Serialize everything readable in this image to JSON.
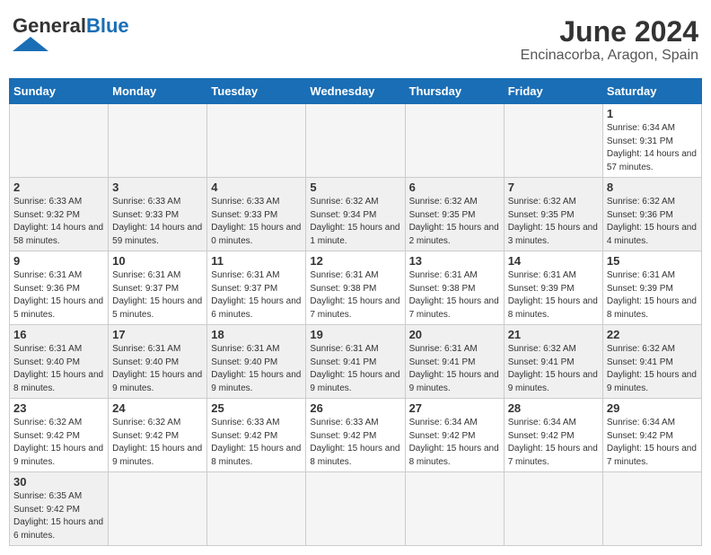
{
  "header": {
    "logo_general": "General",
    "logo_blue": "Blue",
    "month_title": "June 2024",
    "location": "Encinacorba, Aragon, Spain"
  },
  "days_of_week": [
    "Sunday",
    "Monday",
    "Tuesday",
    "Wednesday",
    "Thursday",
    "Friday",
    "Saturday"
  ],
  "weeks": [
    [
      {
        "day": "",
        "info": ""
      },
      {
        "day": "",
        "info": ""
      },
      {
        "day": "",
        "info": ""
      },
      {
        "day": "",
        "info": ""
      },
      {
        "day": "",
        "info": ""
      },
      {
        "day": "",
        "info": ""
      },
      {
        "day": "1",
        "info": "Sunrise: 6:34 AM\nSunset: 9:31 PM\nDaylight: 14 hours and 57 minutes."
      }
    ],
    [
      {
        "day": "2",
        "info": "Sunrise: 6:33 AM\nSunset: 9:32 PM\nDaylight: 14 hours and 58 minutes."
      },
      {
        "day": "3",
        "info": "Sunrise: 6:33 AM\nSunset: 9:33 PM\nDaylight: 14 hours and 59 minutes."
      },
      {
        "day": "4",
        "info": "Sunrise: 6:33 AM\nSunset: 9:33 PM\nDaylight: 15 hours and 0 minutes."
      },
      {
        "day": "5",
        "info": "Sunrise: 6:32 AM\nSunset: 9:34 PM\nDaylight: 15 hours and 1 minute."
      },
      {
        "day": "6",
        "info": "Sunrise: 6:32 AM\nSunset: 9:35 PM\nDaylight: 15 hours and 2 minutes."
      },
      {
        "day": "7",
        "info": "Sunrise: 6:32 AM\nSunset: 9:35 PM\nDaylight: 15 hours and 3 minutes."
      },
      {
        "day": "8",
        "info": "Sunrise: 6:32 AM\nSunset: 9:36 PM\nDaylight: 15 hours and 4 minutes."
      }
    ],
    [
      {
        "day": "9",
        "info": "Sunrise: 6:31 AM\nSunset: 9:36 PM\nDaylight: 15 hours and 5 minutes."
      },
      {
        "day": "10",
        "info": "Sunrise: 6:31 AM\nSunset: 9:37 PM\nDaylight: 15 hours and 5 minutes."
      },
      {
        "day": "11",
        "info": "Sunrise: 6:31 AM\nSunset: 9:37 PM\nDaylight: 15 hours and 6 minutes."
      },
      {
        "day": "12",
        "info": "Sunrise: 6:31 AM\nSunset: 9:38 PM\nDaylight: 15 hours and 7 minutes."
      },
      {
        "day": "13",
        "info": "Sunrise: 6:31 AM\nSunset: 9:38 PM\nDaylight: 15 hours and 7 minutes."
      },
      {
        "day": "14",
        "info": "Sunrise: 6:31 AM\nSunset: 9:39 PM\nDaylight: 15 hours and 8 minutes."
      },
      {
        "day": "15",
        "info": "Sunrise: 6:31 AM\nSunset: 9:39 PM\nDaylight: 15 hours and 8 minutes."
      }
    ],
    [
      {
        "day": "16",
        "info": "Sunrise: 6:31 AM\nSunset: 9:40 PM\nDaylight: 15 hours and 8 minutes."
      },
      {
        "day": "17",
        "info": "Sunrise: 6:31 AM\nSunset: 9:40 PM\nDaylight: 15 hours and 9 minutes."
      },
      {
        "day": "18",
        "info": "Sunrise: 6:31 AM\nSunset: 9:40 PM\nDaylight: 15 hours and 9 minutes."
      },
      {
        "day": "19",
        "info": "Sunrise: 6:31 AM\nSunset: 9:41 PM\nDaylight: 15 hours and 9 minutes."
      },
      {
        "day": "20",
        "info": "Sunrise: 6:31 AM\nSunset: 9:41 PM\nDaylight: 15 hours and 9 minutes."
      },
      {
        "day": "21",
        "info": "Sunrise: 6:32 AM\nSunset: 9:41 PM\nDaylight: 15 hours and 9 minutes."
      },
      {
        "day": "22",
        "info": "Sunrise: 6:32 AM\nSunset: 9:41 PM\nDaylight: 15 hours and 9 minutes."
      }
    ],
    [
      {
        "day": "23",
        "info": "Sunrise: 6:32 AM\nSunset: 9:42 PM\nDaylight: 15 hours and 9 minutes."
      },
      {
        "day": "24",
        "info": "Sunrise: 6:32 AM\nSunset: 9:42 PM\nDaylight: 15 hours and 9 minutes."
      },
      {
        "day": "25",
        "info": "Sunrise: 6:33 AM\nSunset: 9:42 PM\nDaylight: 15 hours and 8 minutes."
      },
      {
        "day": "26",
        "info": "Sunrise: 6:33 AM\nSunset: 9:42 PM\nDaylight: 15 hours and 8 minutes."
      },
      {
        "day": "27",
        "info": "Sunrise: 6:34 AM\nSunset: 9:42 PM\nDaylight: 15 hours and 8 minutes."
      },
      {
        "day": "28",
        "info": "Sunrise: 6:34 AM\nSunset: 9:42 PM\nDaylight: 15 hours and 7 minutes."
      },
      {
        "day": "29",
        "info": "Sunrise: 6:34 AM\nSunset: 9:42 PM\nDaylight: 15 hours and 7 minutes."
      }
    ],
    [
      {
        "day": "30",
        "info": "Sunrise: 6:35 AM\nSunset: 9:42 PM\nDaylight: 15 hours and 6 minutes."
      },
      {
        "day": "",
        "info": ""
      },
      {
        "day": "",
        "info": ""
      },
      {
        "day": "",
        "info": ""
      },
      {
        "day": "",
        "info": ""
      },
      {
        "day": "",
        "info": ""
      },
      {
        "day": "",
        "info": ""
      }
    ]
  ]
}
